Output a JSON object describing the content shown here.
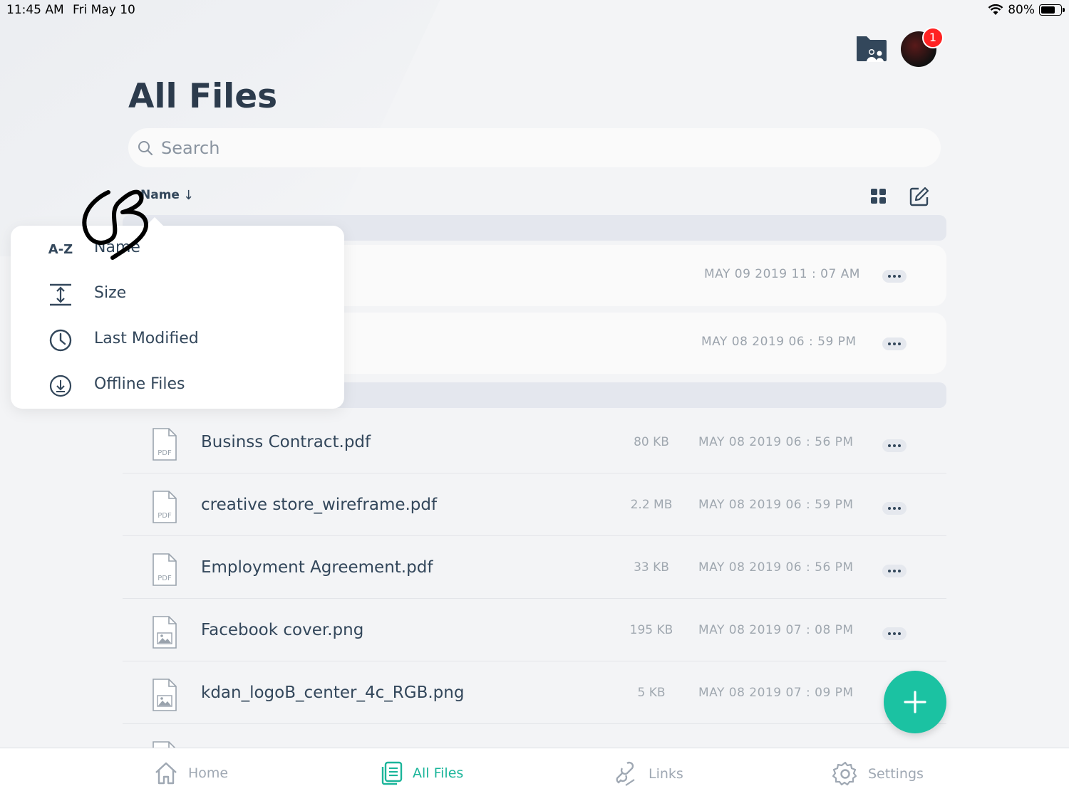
{
  "status_bar": {
    "time": "11:45 AM",
    "date": "Fri May 10",
    "battery_percent": "80%",
    "battery_level": 0.8
  },
  "header": {
    "title": "All Files",
    "notification_count": "1"
  },
  "search": {
    "placeholder": "Search"
  },
  "sort": {
    "label": "Name",
    "arrow": "↓"
  },
  "folders": [
    {
      "date": "MAY 09 2019 11 : 07 AM"
    },
    {
      "date": "MAY 08 2019 06 : 59 PM"
    }
  ],
  "files": [
    {
      "name": "Businss Contract.pdf",
      "size": "80 KB",
      "date": "MAY 08 2019 06 : 56 PM",
      "type": "pdf",
      "type_label": "PDF"
    },
    {
      "name": "creative store_wireframe.pdf",
      "size": "2.2 MB",
      "date": "MAY 08 2019 06 : 59 PM",
      "type": "pdf",
      "type_label": "PDF"
    },
    {
      "name": "Employment Agreement.pdf",
      "size": "33 KB",
      "date": "MAY 08 2019 06 : 56 PM",
      "type": "pdf",
      "type_label": "PDF"
    },
    {
      "name": "Facebook cover.png",
      "size": "195 KB",
      "date": "MAY 08 2019 07 : 08 PM",
      "type": "image"
    },
    {
      "name": "kdan_logoB_center_4c_RGB.png",
      "size": "5 KB",
      "date": "MAY 08 2019 07 : 09 PM",
      "type": "image"
    }
  ],
  "sort_menu": {
    "items": [
      {
        "icon": "az-icon",
        "icon_text": "A-Z",
        "label": "Name"
      },
      {
        "icon": "size-icon",
        "label": "Size"
      },
      {
        "icon": "clock-icon",
        "label": "Last Modified"
      },
      {
        "icon": "download-circle-icon",
        "label": "Offline Files"
      }
    ]
  },
  "tabbar": {
    "tabs": [
      {
        "label": "Home",
        "icon": "home-icon"
      },
      {
        "label": "All Files",
        "icon": "files-icon",
        "active": true
      },
      {
        "label": "Links",
        "icon": "links-icon"
      },
      {
        "label": "Settings",
        "icon": "gear-icon"
      }
    ]
  },
  "colors": {
    "accent": "#1bc2a2",
    "text": "#33475b",
    "badge": "#ff2222"
  }
}
